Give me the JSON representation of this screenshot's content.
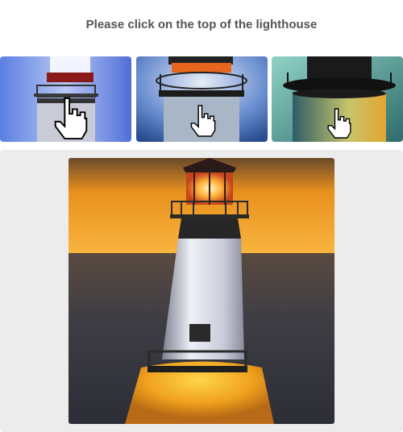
{
  "prompt": {
    "text": "Please click on the top of the lighthouse"
  },
  "examples": [
    {
      "icon": "hand-pointer-icon",
      "theme": "blue-sky"
    },
    {
      "icon": "hand-pointer-icon",
      "theme": "blue-storm"
    },
    {
      "icon": "hand-pointer-icon",
      "theme": "teal-dusk"
    }
  ],
  "colors": {
    "prompt_text": "#555555",
    "panel_bg": "#ececec",
    "sunset_top": "#6b4a2a",
    "sunset_glow": "#f5a41c",
    "sea": "#3b3a40"
  }
}
